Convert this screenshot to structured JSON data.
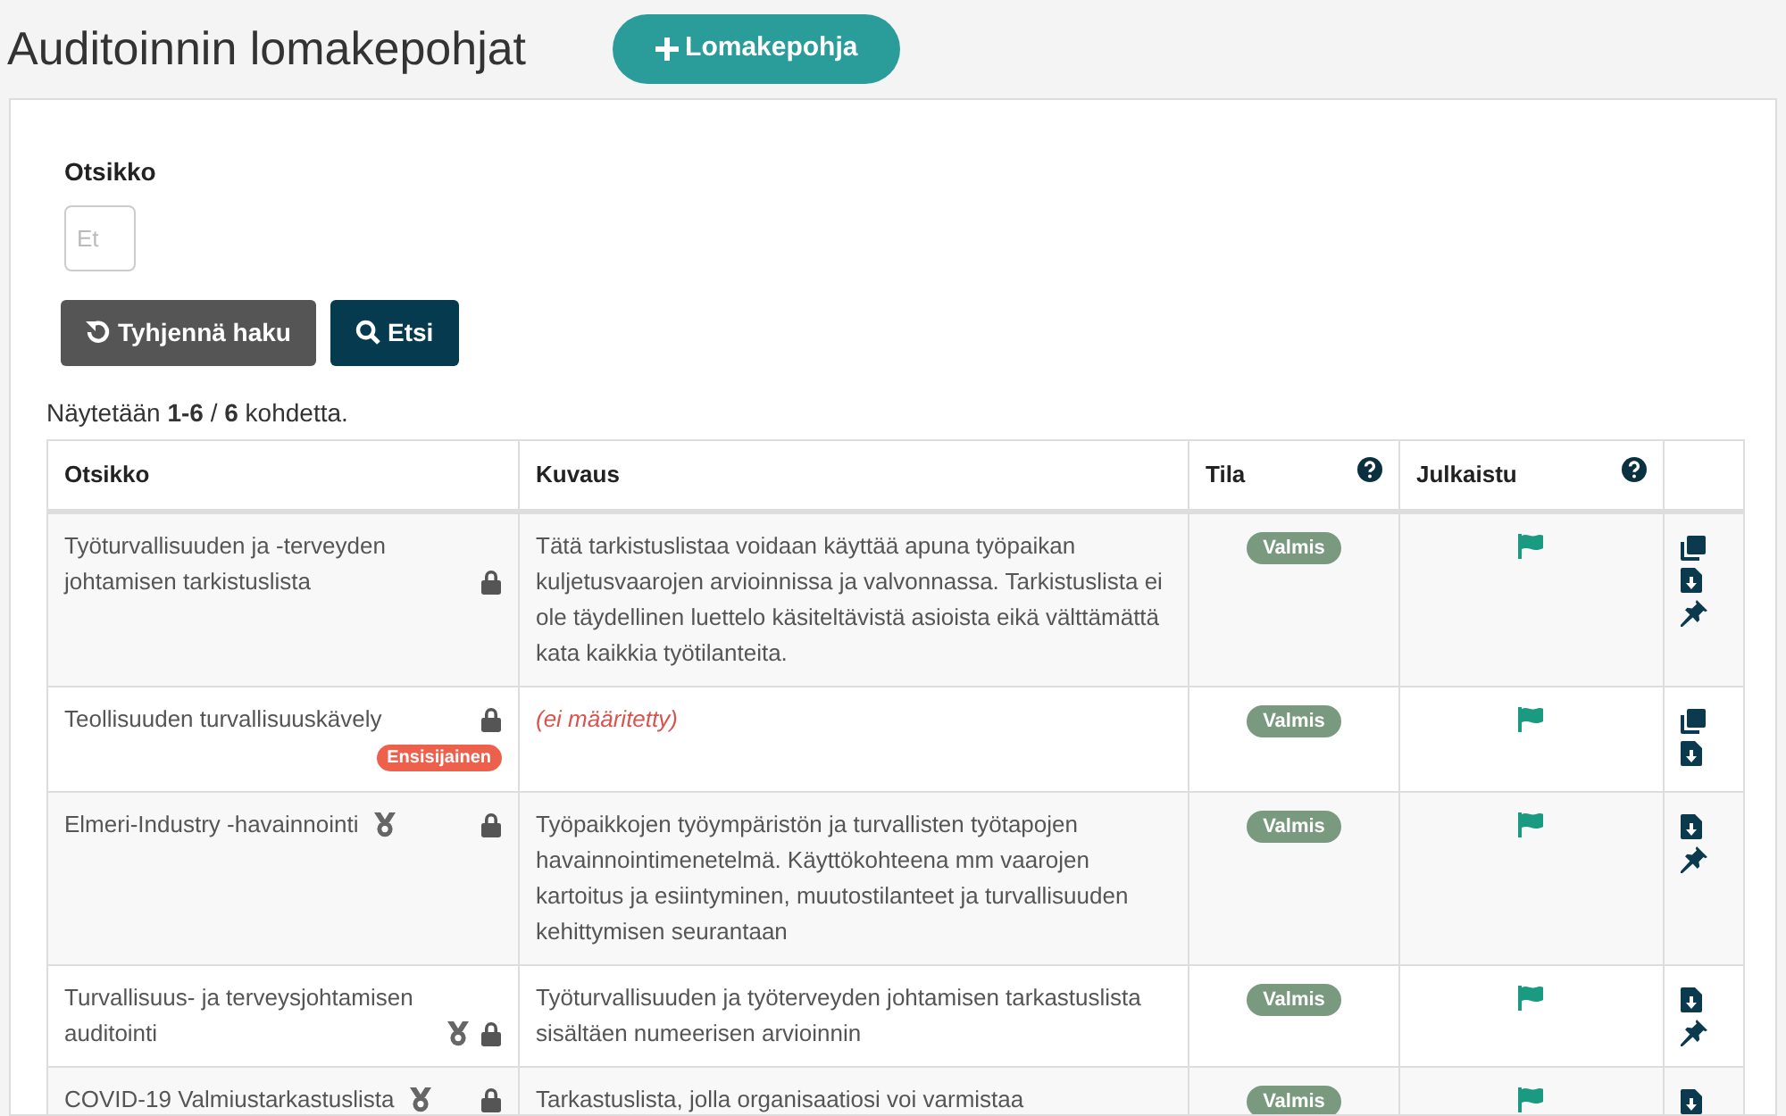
{
  "page_title": "Auditoinnin lomakepohjat",
  "add_button": {
    "label": "Lomakepohja"
  },
  "filter": {
    "label": "Otsikko",
    "placeholder": "Et"
  },
  "buttons": [
    {
      "kind": "reset",
      "label": "Tyhjennä haku"
    },
    {
      "kind": "search",
      "label": "Etsi"
    }
  ],
  "summary": "Näytetään **1-6** / **6** kohdetta.",
  "table": {
    "columns": [
      {
        "label": "Otsikko",
        "help": false
      },
      {
        "label": "Kuvaus",
        "help": false
      },
      {
        "label": "Tila",
        "help": true
      },
      {
        "label": "Julkaistu",
        "help": true
      }
    ],
    "rows": [
      {
        "title": "Työturvallisuuden ja -terveyden johtamisen tarkistuslista",
        "medal": false,
        "locked": true,
        "badge": null,
        "description": "Tätä tarkistuslistaa voidaan käyttää apuna työpaikan kuljetusvaarojen arvioinnissa ja valvonnassa. Tarkistuslista ei ole täydellinen luettelo käsiteltävistä asioista eikä välttämättä kata kaikkia työtilanteita.",
        "description_missing": false,
        "status": "Valmis",
        "published": true,
        "actions": [
          {
            "kind": "copy"
          },
          {
            "kind": "download"
          },
          {
            "kind": "pin"
          }
        ]
      },
      {
        "title": "Teollisuuden turvallisuuskävely",
        "medal": false,
        "locked": true,
        "badge": "Ensisijainen",
        "description": "(ei määritetty)",
        "description_missing": true,
        "status": "Valmis",
        "published": true,
        "actions": [
          {
            "kind": "copy"
          },
          {
            "kind": "download"
          }
        ]
      },
      {
        "title": "Elmeri-Industry -havainnointi",
        "medal": true,
        "locked": true,
        "badge": null,
        "description": "Työpaikkojen työympäristön ja turvallisten työtapojen havainnointimenetelmä. Käyttökohteena mm vaarojen kartoitus ja esiintyminen, muutostilanteet ja turvallisuuden kehittymisen seurantaan",
        "description_missing": false,
        "status": "Valmis",
        "published": true,
        "actions": [
          {
            "kind": "download"
          },
          {
            "kind": "pin"
          }
        ]
      },
      {
        "title": "Turvallisuus- ja terveysjohtamisen auditointi",
        "medal": true,
        "locked": true,
        "badge": null,
        "description": "Työturvallisuuden ja työterveyden johtamisen tarkastuslista sisältäen numeerisen arvioinnin",
        "description_missing": false,
        "status": "Valmis",
        "published": true,
        "actions": [
          {
            "kind": "download"
          },
          {
            "kind": "pin"
          }
        ]
      },
      {
        "title": "COVID-19 Valmiustarkastuslista",
        "medal": true,
        "locked": true,
        "badge": null,
        "description": "Tarkastuslista, jolla organisaatiosi voi varmistaa",
        "description_missing": false,
        "status": "Valmis",
        "published": true,
        "actions": [
          {
            "kind": "download"
          }
        ]
      }
    ]
  }
}
